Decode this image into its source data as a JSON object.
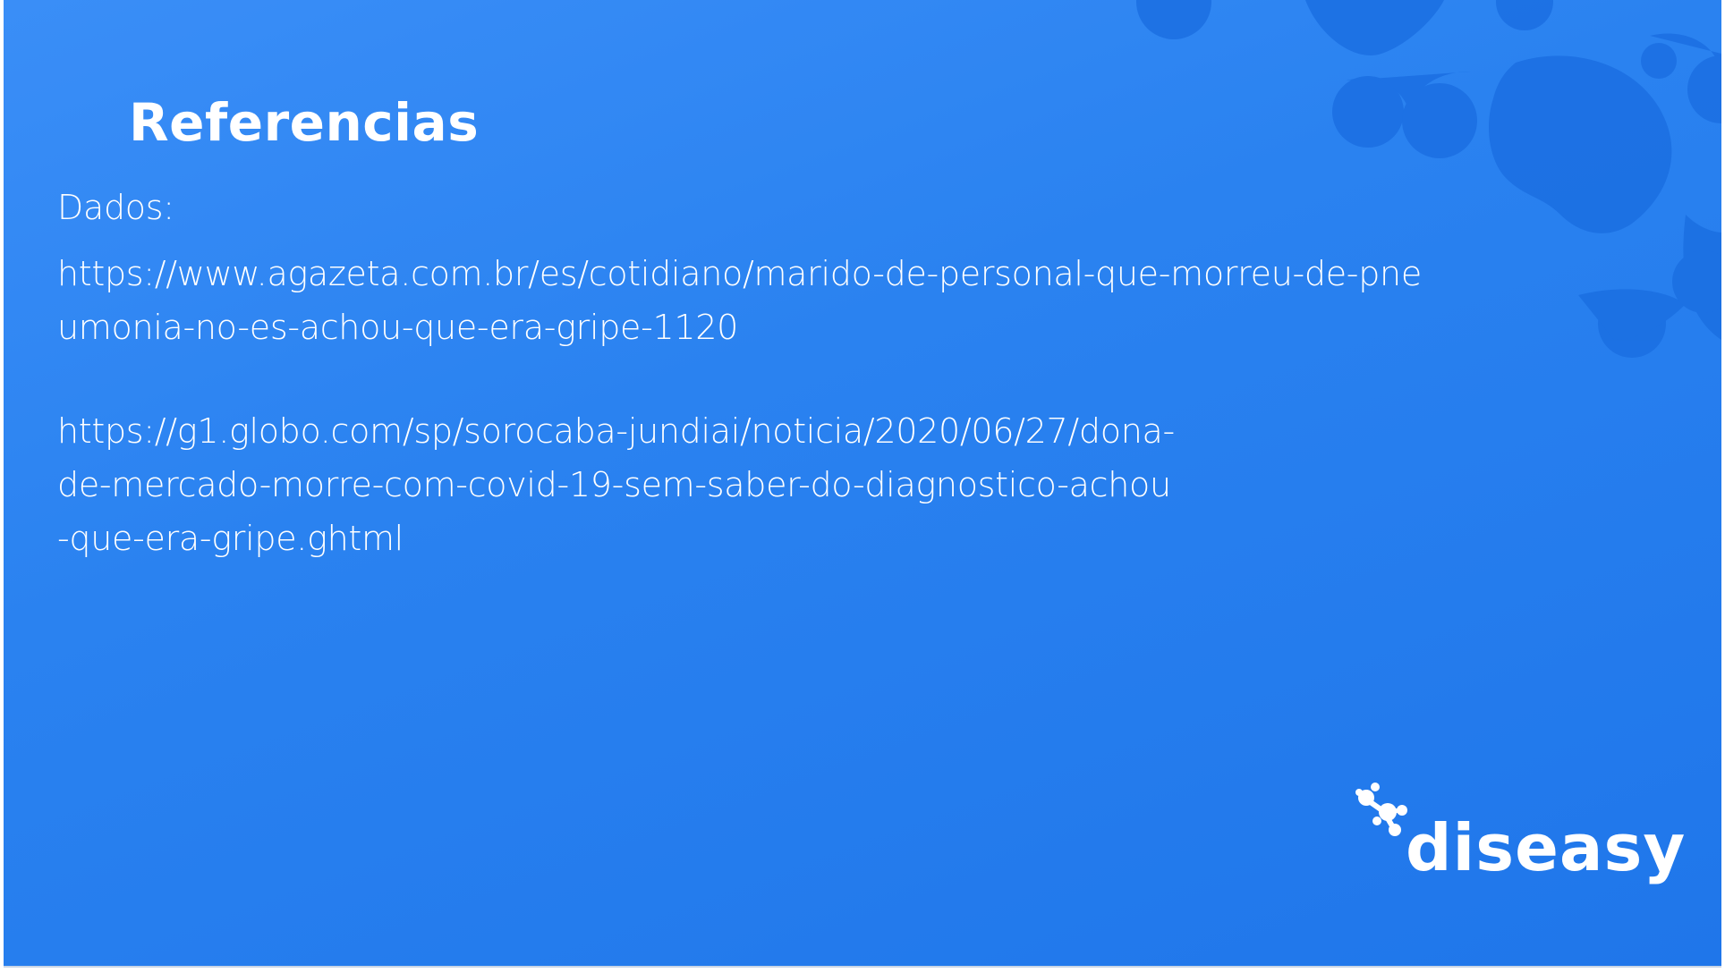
{
  "slide": {
    "title": "Referencias",
    "label": "Dados:",
    "ref1_lines": [
      "https://www.agazeta.com.br/es/cotidiano/marido-de-personal-que-morreu-de-pne",
      "umonia-no-es-achou-que-era-gripe-1120"
    ],
    "ref2_lines": [
      "https://g1.globo.com/sp/sorocaba-jundiai/noticia/2020/06/27/dona-",
      "de-mercado-morre-com-covid-19-sem-saber-do-diagnostico-achou",
      "-que-era-gripe.ghtml"
    ]
  },
  "logo": {
    "text": "diseasy"
  },
  "colors": {
    "background": "#2a82f0",
    "blob": "#1a6fe0",
    "text": "#ffffff"
  }
}
